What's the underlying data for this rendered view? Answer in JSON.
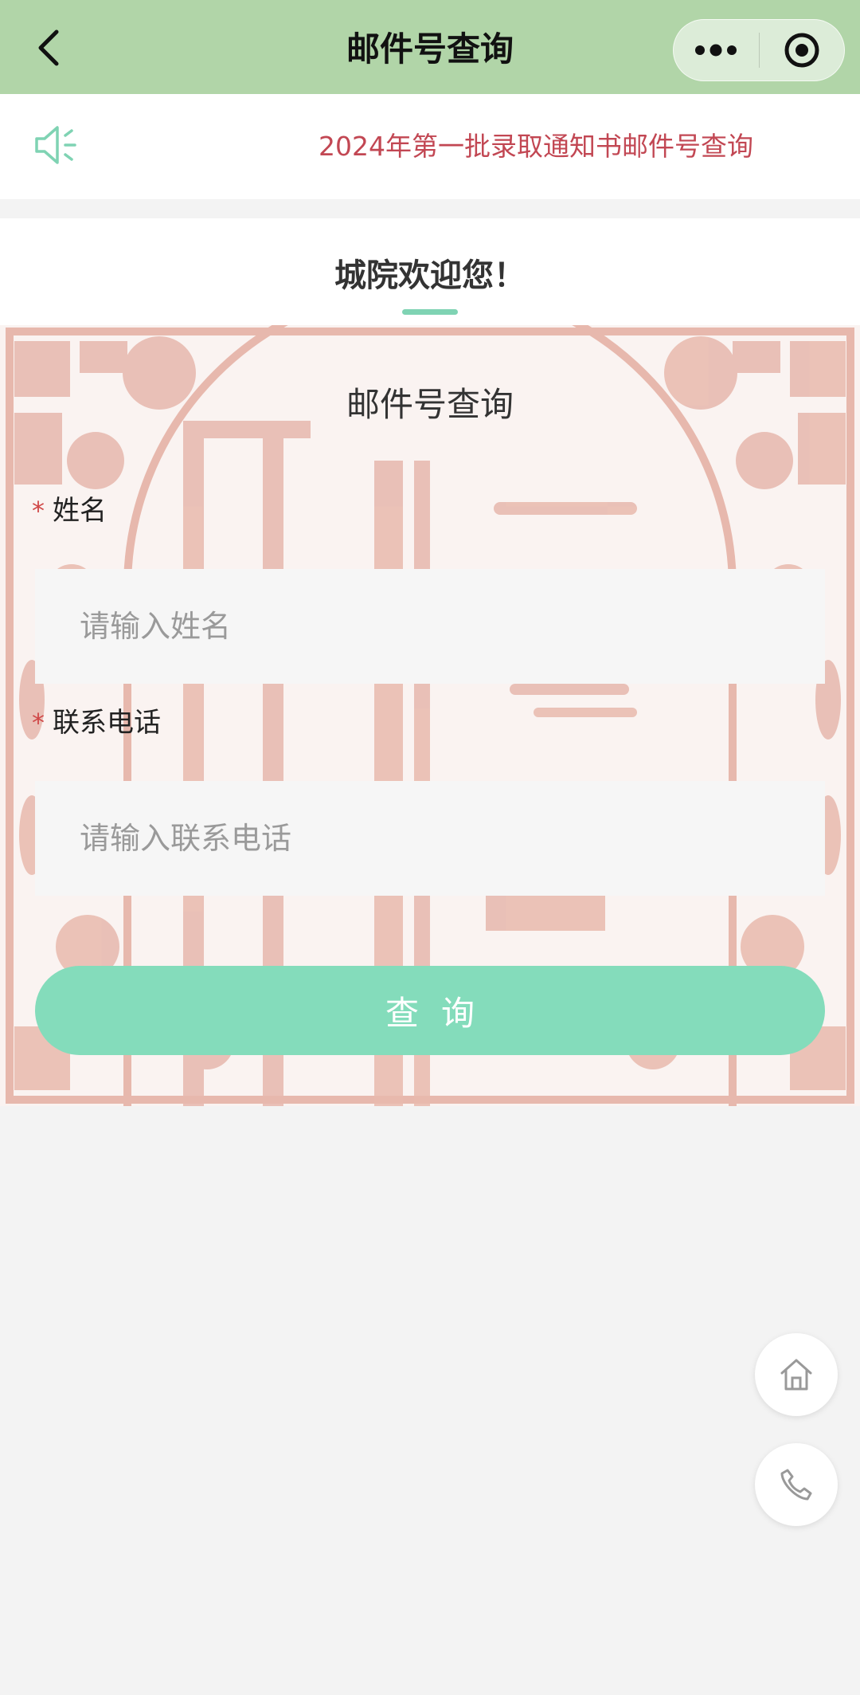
{
  "navbar": {
    "title": "邮件号查询",
    "back_icon": "chevron-left-icon",
    "more_icon": "more-dots-icon",
    "close_icon": "target-circle-icon"
  },
  "notice": {
    "icon": "speaker-icon",
    "text": "2024年第一批录取通知书邮件号查询",
    "text_color": "#c24753"
  },
  "welcome": {
    "title": "城院欢迎您！",
    "accent_color": "#7fd3b3"
  },
  "form": {
    "heading": "邮件号查询",
    "fields": [
      {
        "required_mark": "*",
        "label": "姓名",
        "placeholder": "请输入姓名",
        "value": ""
      },
      {
        "required_mark": "*",
        "label": "联系电话",
        "placeholder": "请输入联系电话",
        "value": ""
      }
    ],
    "submit_label": "查询",
    "button_color": "#84dcbb"
  },
  "floating": {
    "home_icon": "home-icon",
    "phone_icon": "phone-icon"
  },
  "colors": {
    "navbar_bg": "#b1d5a8",
    "page_bg": "#f3f3f3",
    "papercut": "#e7b8ad"
  }
}
